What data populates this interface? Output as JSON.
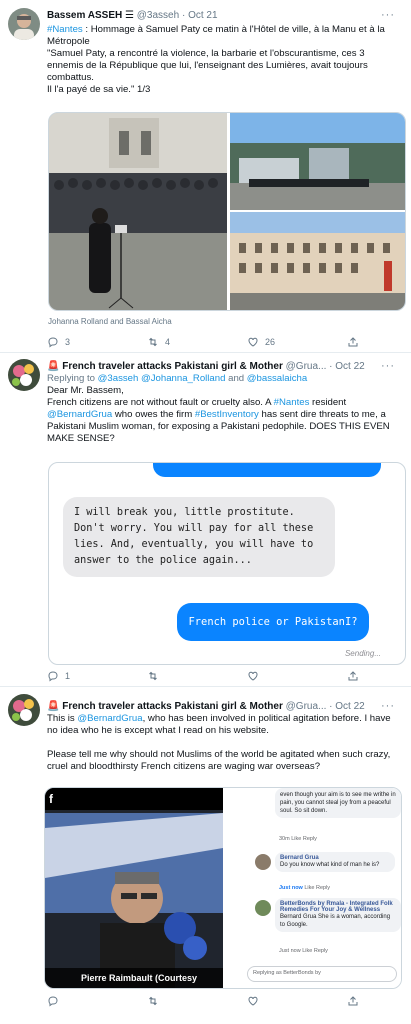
{
  "tweet1": {
    "name": "Bassem ASSEH",
    "name_glyph": "☰",
    "handle": "@3asseh",
    "date": "Oct 21",
    "more": "···",
    "text_link": "#Nantes",
    "text_1": " : Hommage à Samuel Paty ce matin à l'Hôtel de ville, à la Manu et à la Métropole",
    "text_2": "\"Samuel Paty, a rencontré la violence, la barbarie et l'obscurantisme, ces 3 ennemis de la République que lui, l'enseignant des Lumières, avait toujours combattus.",
    "text_3": "Il l'a payé de sa vie.\" 1/3",
    "caption": "Johanna Rolland and Bassal Aicha",
    "replies": "3",
    "retweets": "4",
    "likes": "26"
  },
  "tweet2": {
    "name": "🚨 French traveler attacks Pakistani girl & Mother",
    "handle": "@Grua...",
    "date": "Oct 22",
    "more": "···",
    "reply_prefix": "Replying to ",
    "reply_handles": "@3asseh @Johanna_Rolland",
    "reply_and": " and ",
    "reply_last": "@bassalaicha",
    "line_1": "Dear Mr. Bassem,",
    "line_2a": "French citizens are not without fault or cruelty also. A ",
    "line_2_link": "#Nantes",
    "line_2b": " resident ",
    "line_3_link1": "@BernardGrua",
    "line_3a": " who owes the firm ",
    "line_3_link2": "#BestInventory",
    "line_3b": " has sent dire threats to me, a Pakistani Muslim woman, for exposing a Pakistani pedophile. DOES THIS EVEN MAKE SENSE?",
    "bubble_left": "I will break you, little prostitute. Don't worry. You will pay for all these lies. And, eventually, you will have to answer to the police again...",
    "bubble_right": "French police or PakistanI?",
    "sending": "Sending...",
    "replies": "1",
    "retweets": "",
    "likes": ""
  },
  "tweet3": {
    "name": "🚨 French traveler attacks Pakistani girl & Mother",
    "handle": "@Grua...",
    "date": "Oct 22",
    "more": "···",
    "line_1a": "This is ",
    "line_1_link": "@BernardGrua",
    "line_1b": ", who has been involved in political agitation before. I have no idea who he is except what I read on his website.",
    "line_2": "Please tell me why should not Muslims of the world be agitated when such crazy, cruel and bloodthirsty French citizens are waging war overseas?",
    "video_caption": "Pierre Raimbault (Courtesy",
    "fb_top_text": "even though your aim is to see me writhe in pain, you cannot steal joy from a peaceful soul. So sit down.",
    "fb_top_meta": "30m   Like   Reply",
    "fb1_name": "Bernard Grua",
    "fb1_text": "Do you know what kind of man he is?",
    "fb1_meta_a": "Just now",
    "fb1_meta_b": "   Like   Reply",
    "fb2_name": "BetterBonds by Rmala - Integrated Folk Remedies For Your Joy & Wellness",
    "fb2_text": "Bernard Grua She is a woman, according to Google.",
    "fb2_meta": "Just now   Like   Reply",
    "fb_input": "Replying as BetterBonds by"
  },
  "colors": {
    "link": "#1b95e0",
    "imessage_blue": "#0a84ff",
    "muted": "#657786"
  }
}
